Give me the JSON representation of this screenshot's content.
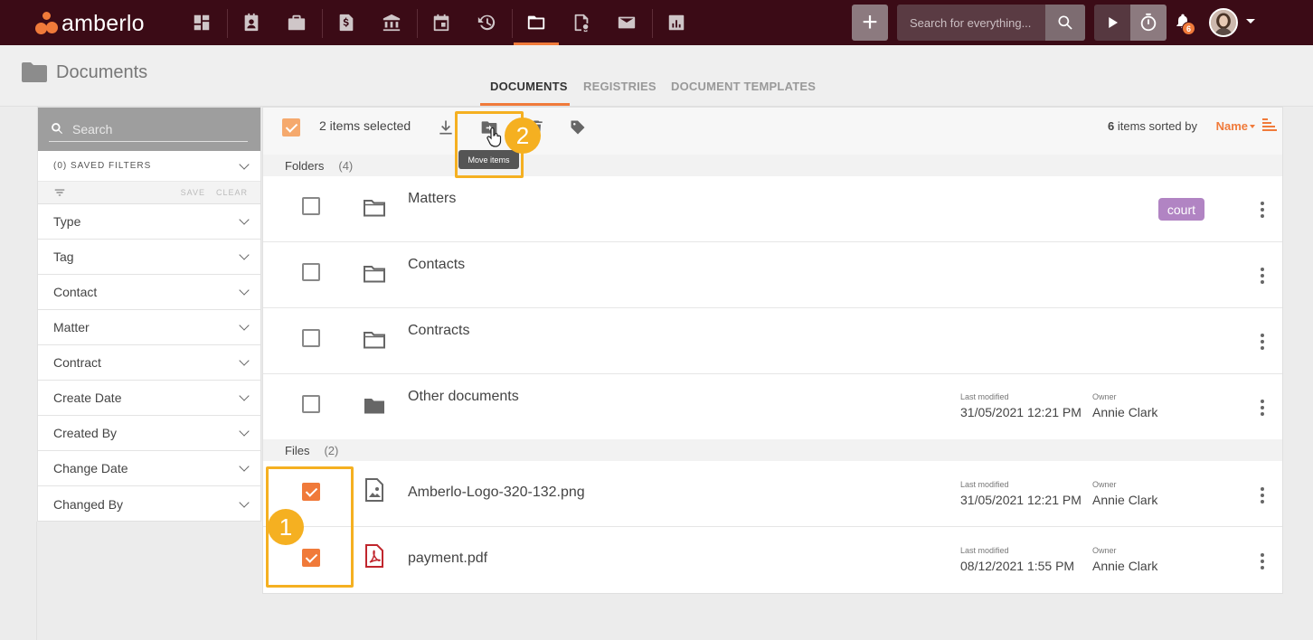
{
  "app": {
    "logo_text": "amberlo",
    "brand_color": "#3b0b16",
    "accent_color": "#f07a3a",
    "highlight_color": "#f5b021"
  },
  "nav": {
    "icons": [
      "dashboard-icon",
      "contacts-icon",
      "matters-icon",
      "invoices-icon",
      "bank-icon",
      "calendar-icon",
      "time-history-icon",
      "documents-icon",
      "registries-icon",
      "mail-icon",
      "reports-icon"
    ],
    "active": "documents-icon"
  },
  "header": {
    "search_placeholder": "Search for everything...",
    "notification_count": "6"
  },
  "page": {
    "title": "Documents",
    "tabs": [
      {
        "label": "DOCUMENTS",
        "active": true
      },
      {
        "label": "REGISTRIES",
        "active": false
      },
      {
        "label": "DOCUMENT TEMPLATES",
        "active": false
      }
    ]
  },
  "sidebar": {
    "search_placeholder": "Search",
    "saved_filters": "(0)  SAVED FILTERS",
    "save_label": "SAVE",
    "clear_label": "CLEAR",
    "filters": [
      "Type",
      "Tag",
      "Contact",
      "Matter",
      "Contract",
      "Create Date",
      "Created By",
      "Change Date",
      "Changed By"
    ]
  },
  "toolbar": {
    "selected_text": "2 items selected",
    "items_count": "6",
    "sorted_by_text": " items sorted by",
    "sort_field": "Name",
    "tooltip": "Move items"
  },
  "folders": {
    "label": "Folders",
    "count": "(4)",
    "items": [
      {
        "name": "Matters",
        "tag": "court",
        "last_modified": "",
        "owner": "",
        "checked": false
      },
      {
        "name": "Contacts",
        "tag": "",
        "last_modified": "",
        "owner": "",
        "checked": false
      },
      {
        "name": "Contracts",
        "tag": "",
        "last_modified": "",
        "owner": "",
        "checked": false
      },
      {
        "name": "Other documents",
        "tag": "",
        "last_modified": "31/05/2021 12:21 PM",
        "owner": "Annie Clark",
        "checked": false
      }
    ]
  },
  "files": {
    "label": "Files",
    "count": "(2)",
    "items": [
      {
        "name": "Amberlo-Logo-320-132.png",
        "last_modified": "31/05/2021 12:21 PM",
        "owner": "Annie Clark",
        "checked": true
      },
      {
        "name": "payment.pdf",
        "last_modified": "08/12/2021 1:55 PM",
        "owner": "Annie Clark",
        "checked": true
      }
    ]
  },
  "meta_labels": {
    "last_modified": "Last modified",
    "owner": "Owner"
  },
  "annotations": {
    "step1": "1",
    "step2": "2"
  }
}
